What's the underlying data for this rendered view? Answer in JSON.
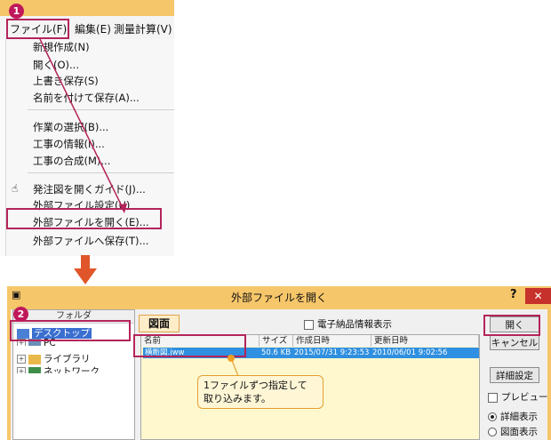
{
  "menu_screen": {
    "menubar": [
      "ファイル(F)",
      "編集(E)",
      "測量計算(V)"
    ],
    "items": [
      "新規作成(N)",
      "開く(O)...",
      "上書き保存(S)",
      "名前を付けて保存(A)...",
      "作業の選択(B)...",
      "工事の情報(I)...",
      "工事の合成(M)...",
      "発注図を開くガイド(J)...",
      "外部ファイル設定(U)",
      "外部ファイルを開く(E)...",
      "外部ファイルへ保存(T)..."
    ]
  },
  "steps": [
    "1",
    "2"
  ],
  "dialog": {
    "title": "外部ファイルを開く",
    "help": "?",
    "close": "✕",
    "folder_header": "フォルダ",
    "tree": [
      "デスクトップ",
      "PC",
      "ライブラリ",
      "ネットワーク"
    ],
    "tab": "図面",
    "elec_checkbox": "電子納品情報表示",
    "columns": [
      "名前",
      "サイズ",
      "作成日時",
      "更新日時"
    ],
    "file": {
      "name": "横断図.jww",
      "size": "50.6 KB",
      "created": "2015/07/31 9:23:53",
      "modified": "2010/06/01 9:02:56"
    },
    "buttons": {
      "open": "開く",
      "cancel": "キャンセル",
      "detail": "詳細設定"
    },
    "preview": "プレビュー",
    "radio_detail": "詳細表示",
    "radio_figure": "図面表示"
  },
  "callout_lines": [
    "1ファイルずつ指定して",
    "取り込みます。"
  ],
  "colors": {
    "accent": "#b4245a",
    "arrow": "#e0562a",
    "titlebar": "#f6c66a",
    "selection": "#2f8fe0"
  }
}
